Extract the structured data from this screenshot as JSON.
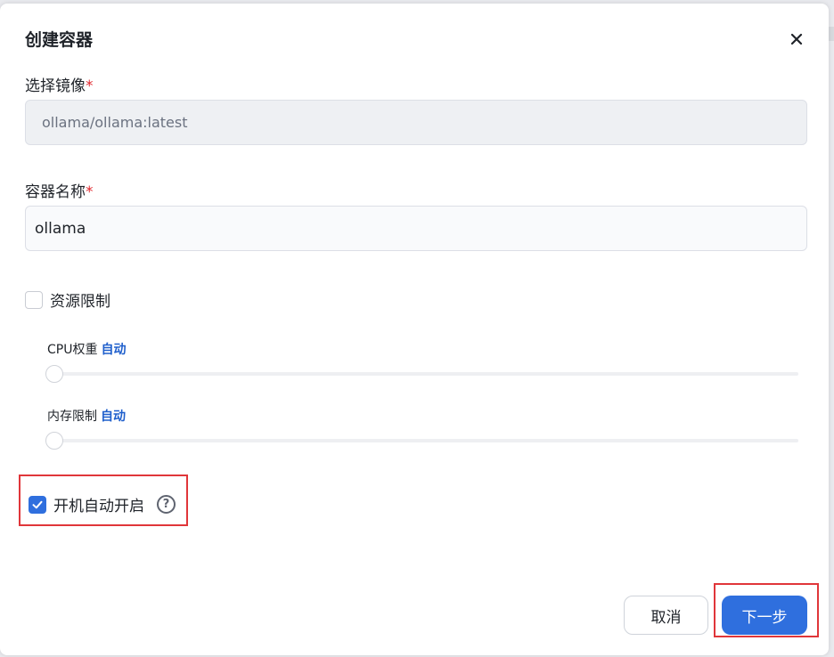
{
  "dialog": {
    "title": "创建容器",
    "close_icon": "close-icon"
  },
  "image_field": {
    "label": "选择镜像",
    "required_mark": "*",
    "value": "ollama/ollama:latest"
  },
  "name_field": {
    "label": "容器名称",
    "required_mark": "*",
    "value": "ollama"
  },
  "resource_limit": {
    "label": "资源限制",
    "checked": false
  },
  "cpu": {
    "label": "CPU权重",
    "value": "自动",
    "level": 0
  },
  "memory": {
    "label": "内存限制",
    "value": "自动",
    "level": 0
  },
  "autostart": {
    "label": "开机自动开启",
    "checked": true,
    "help_icon": "question-circle-icon",
    "help_glyph": "?"
  },
  "footer": {
    "cancel_label": "取消",
    "next_label": "下一步"
  },
  "colors": {
    "primary": "#2f6fde",
    "required": "#e0282e",
    "highlight": "#e0363a",
    "auto_text": "#1f5fcc"
  }
}
